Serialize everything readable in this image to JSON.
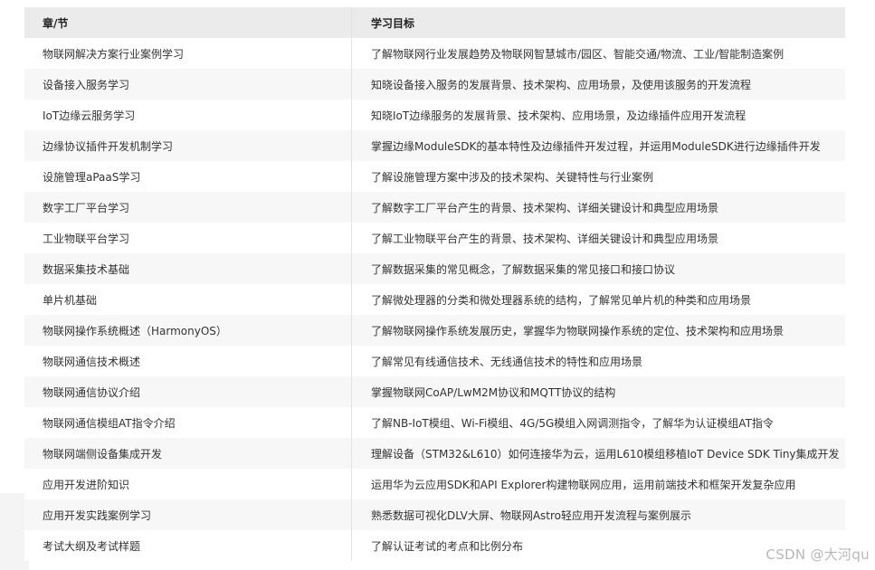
{
  "table": {
    "headers": [
      "章/节",
      "学习目标"
    ],
    "rows": [
      [
        "物联网解决方案行业案例学习",
        "了解物联网行业发展趋势及物联网智慧城市/园区、智能交通/物流、工业/智能制造案例"
      ],
      [
        "设备接入服务学习",
        "知晓设备接入服务的发展背景、技术架构、应用场景，及使用该服务的开发流程"
      ],
      [
        "IoT边缘云服务学习",
        "知晓IoT边缘服务的发展背景、技术架构、应用场景，及边缘插件应用开发流程"
      ],
      [
        "边缘协议插件开发机制学习",
        "掌握边缘ModuleSDK的基本特性及边缘插件开发过程，并运用ModuleSDK进行边缘插件开发"
      ],
      [
        "设施管理aPaaS学习",
        "了解设施管理方案中涉及的技术架构、关键特性与行业案例"
      ],
      [
        "数字工厂平台学习",
        "了解数字工厂平台产生的背景、技术架构、详细关键设计和典型应用场景"
      ],
      [
        "工业物联平台学习",
        "了解工业物联平台产生的背景、技术架构、详细关键设计和典型应用场景"
      ],
      [
        "数据采集技术基础",
        "了解数据采集的常见概念，了解数据采集的常见接口和接口协议"
      ],
      [
        "单片机基础",
        "了解微处理器的分类和微处理器系统的结构，了解常见单片机的种类和应用场景"
      ],
      [
        "物联网操作系统概述（HarmonyOS）",
        "了解物联网操作系统发展历史，掌握华为物联网操作系统的定位、技术架构和应用场景"
      ],
      [
        "物联网通信技术概述",
        "了解常见有线通信技术、无线通信技术的特性和应用场景"
      ],
      [
        "物联网通信协议介绍",
        "掌握物联网CoAP/LwM2M协议和MQTT协议的结构"
      ],
      [
        "物联网通信模组AT指令介绍",
        "了解NB-IoT模组、Wi-Fi模组、4G/5G模组入网调测指令，了解华为认证模组AT指令"
      ],
      [
        "物联网端侧设备集成开发",
        "理解设备（STM32&L610）如何连接华为云，运用L610模组移植IoT Device SDK Tiny集成开发"
      ],
      [
        "应用开发进阶知识",
        "运用华为云应用SDK和API Explorer构建物联网应用，运用前端技术和框架开发复杂应用"
      ],
      [
        "应用开发实践案例学习",
        "熟悉数据可视化DLV大屏、物联网Astro轻应用开发流程与案例展示"
      ],
      [
        "考试大纲及考试样题",
        "了解认证考试的考点和比例分布"
      ]
    ]
  },
  "watermark": "CSDN @大河qu"
}
